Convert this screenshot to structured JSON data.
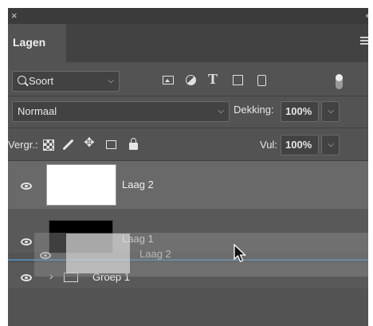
{
  "panel": {
    "close_glyph": "×",
    "collapse_glyph": "‹‹",
    "tab_label": "Lagen",
    "menu_icon": "panel-menu-icon"
  },
  "filter": {
    "kind_label": "Soort",
    "kind_icon": "search-icon",
    "type_glyph": "T",
    "icons": [
      "image-filter-icon",
      "adjustment-filter-icon",
      "type-filter-icon",
      "shape-filter-icon",
      "smart-object-filter-icon",
      "filter-toggle-icon"
    ]
  },
  "blend": {
    "mode": "Normaal",
    "opacity_label": "Dekking:",
    "opacity_value": "100%"
  },
  "lock": {
    "label": "Vergr.:",
    "fill_label": "Vul:",
    "fill_value": "100%",
    "move_glyph": "✥",
    "icons": [
      "lock-transparent-pixels-icon",
      "lock-image-pixels-icon",
      "lock-position-icon",
      "lock-artboard-icon",
      "lock-all-icon"
    ]
  },
  "layers": [
    {
      "name": "Laag 2",
      "visible": true,
      "selected": true,
      "thumbnail": "white"
    },
    {
      "name": "Laag 1",
      "visible": true,
      "selected": false,
      "thumbnail": "black"
    },
    {
      "name": "Groep 1",
      "visible": true,
      "selected": false,
      "type": "group",
      "expand_glyph": "›"
    }
  ],
  "drag": {
    "ghost_name": "Laag 2"
  },
  "colors": {
    "panel_bg": "#535353",
    "selected_row": "#696969",
    "drop_indicator": "#4f86b0"
  }
}
